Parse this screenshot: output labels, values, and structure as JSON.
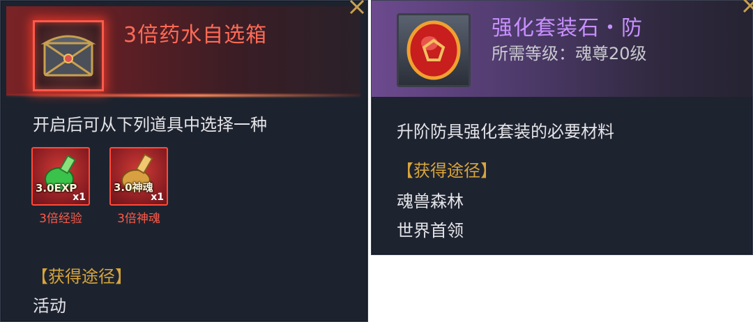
{
  "left_panel": {
    "title": "3倍药水自选箱",
    "description": "开启后可从下列道具中选择一种",
    "rewards": [
      {
        "tag": "3.0EXP",
        "count": "x1",
        "label": "3倍经验"
      },
      {
        "tag": "3.0神魂",
        "count": "x1",
        "label": "3倍神魂"
      }
    ],
    "source_title": "【获得途径】",
    "sources": [
      "活动"
    ]
  },
  "right_panel": {
    "title": "强化套装石・防",
    "subtitle": "所需等级：魂尊20级",
    "description": "升阶防具强化套装的必要材料",
    "source_title": "【获得途径】",
    "sources": [
      "魂兽森林",
      "世界首领"
    ]
  },
  "colors": {
    "rare_red": "#ff6a55",
    "epic_purple": "#c890ff",
    "gold": "#d8a53a"
  }
}
